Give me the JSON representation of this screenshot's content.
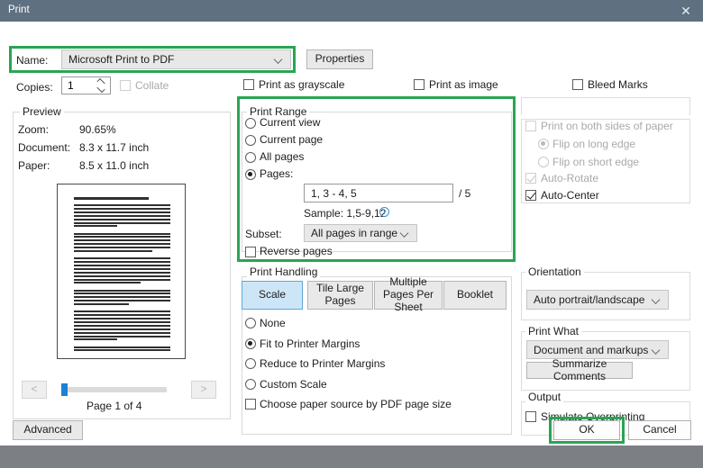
{
  "window": {
    "title": "Print",
    "close_icon": "close-icon"
  },
  "printer": {
    "name_label": "Name:",
    "name_value": "Microsoft Print to PDF",
    "properties_button": "Properties",
    "copies_label": "Copies:",
    "copies_value": "1",
    "collate_label": "Collate",
    "collate_checked": false,
    "collate_enabled": false,
    "print_as_grayscale_label": "Print as grayscale",
    "print_as_grayscale_checked": false,
    "print_as_image_label": "Print as image",
    "print_as_image_checked": false,
    "bleed_marks_label": "Bleed Marks",
    "bleed_marks_checked": false
  },
  "preview": {
    "group_title": "Preview",
    "zoom_label": "Zoom:",
    "zoom_value": "90.65%",
    "document_label": "Document:",
    "document_value": "8.3 x 11.7 inch",
    "paper_label": "Paper:",
    "paper_value": "8.5 x 11.0 inch",
    "prev_button": "<",
    "next_button": ">",
    "page_status": "Page 1 of 4"
  },
  "print_range": {
    "group_title": "Print Range",
    "options": [
      {
        "label": "Current view",
        "selected": false
      },
      {
        "label": "Current page",
        "selected": false
      },
      {
        "label": "All pages",
        "selected": false
      },
      {
        "label": "Pages:",
        "selected": true
      }
    ],
    "pages_value": "1, 3 - 4, 5",
    "pages_total": "/ 5",
    "sample_text": "Sample: 1,5-9,12",
    "sample_info_icon": "info-icon",
    "subset_label": "Subset:",
    "subset_value": "All pages in range",
    "reverse_pages_label": "Reverse pages",
    "reverse_pages_checked": false
  },
  "print_handling": {
    "group_title": "Print Handling",
    "tabs": [
      {
        "label": "Scale",
        "selected": true
      },
      {
        "label": "Tile Large Pages",
        "selected": false
      },
      {
        "label": "Multiple Pages Per Sheet",
        "selected": false
      },
      {
        "label": "Booklet",
        "selected": false
      }
    ],
    "scale_options": [
      {
        "label": "None",
        "selected": false
      },
      {
        "label": "Fit to Printer Margins",
        "selected": true
      },
      {
        "label": "Reduce to Printer Margins",
        "selected": false
      },
      {
        "label": "Custom Scale",
        "selected": false
      }
    ],
    "paper_source_label": "Choose paper source by PDF page size",
    "paper_source_checked": false
  },
  "duplex": {
    "both_sides_label": "Print on both sides of paper",
    "both_sides_checked": false,
    "both_sides_enabled": false,
    "flip_long_label": "Flip on long edge",
    "flip_long_selected": true,
    "flip_short_label": "Flip on short edge",
    "flip_short_selected": false,
    "auto_rotate_label": "Auto-Rotate",
    "auto_rotate_checked": true,
    "auto_rotate_enabled": false,
    "auto_center_label": "Auto-Center",
    "auto_center_checked": true
  },
  "orientation": {
    "group_title": "Orientation",
    "value": "Auto portrait/landscape"
  },
  "print_what": {
    "group_title": "Print What",
    "value": "Document and markups",
    "summarize_button": "Summarize Comments"
  },
  "output": {
    "group_title": "Output",
    "simulate_overprinting_label": "Simulate Overprinting",
    "simulate_overprinting_checked": false
  },
  "footer": {
    "advanced_button": "Advanced",
    "ok_button": "OK",
    "cancel_button": "Cancel"
  },
  "highlights": {
    "accent_color": "#2aa453",
    "regions": [
      "printer-name-row",
      "print-range-group",
      "ok-button"
    ]
  }
}
